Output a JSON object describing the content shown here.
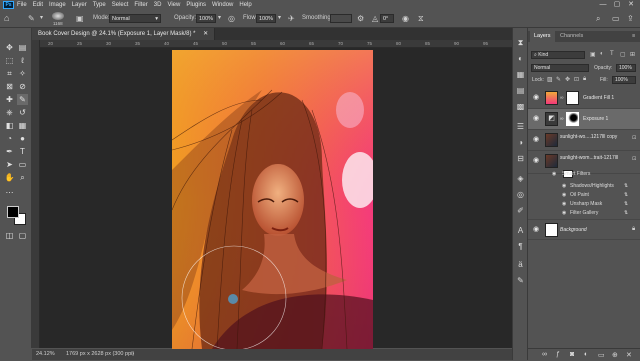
{
  "menu": {
    "logo": "Ps",
    "items": [
      "File",
      "Edit",
      "Image",
      "Layer",
      "Type",
      "Select",
      "Filter",
      "3D",
      "View",
      "Plugins",
      "Window",
      "Help"
    ]
  },
  "window_controls": {
    "minimize": "—",
    "maximize": "▢",
    "close": "✕"
  },
  "options_bar": {
    "brush_size": "1168",
    "mode_label": "Mode:",
    "mode_value": "Normal",
    "opacity_label": "Opacity:",
    "opacity_value": "100%",
    "flow_label": "Flow:",
    "flow_value": "100%",
    "smoothing_label": "Smoothing:",
    "angle_value": "0°"
  },
  "document": {
    "tab_title": "Book Cover Design @ 24.1% (Exposure 1, Layer Mask/8) *",
    "ruler_marks": [
      "20",
      "25",
      "30",
      "35",
      "40",
      "45",
      "50",
      "55",
      "60",
      "65",
      "70",
      "75",
      "80",
      "85",
      "90",
      "95"
    ],
    "zoom": "24.12%",
    "doc_info": "1769 px x 2628 px (300 ppi)"
  },
  "layers_panel": {
    "tabs": [
      "Layers",
      "Channels"
    ],
    "kind_label": "Kind",
    "blend_mode": "Normal",
    "opacity_label": "Opacity:",
    "opacity_value": "100%",
    "lock_label": "Lock:",
    "fill_label": "Fill:",
    "fill_value": "100%",
    "layers": [
      {
        "name": "Gradient Fill 1"
      },
      {
        "name": "Exposure 1"
      },
      {
        "name": "sunlight-wo....1217lll copy"
      },
      {
        "name": "sunlight-wom...trait-1217lll"
      }
    ],
    "smart_filters_label": "Smart Filters",
    "filters": [
      "Shadows/Highlights",
      "Oil Paint",
      "Unsharp Mask",
      "Filter Gallery"
    ],
    "background_layer": "Background"
  },
  "colors": {
    "canvas_top": "#f2a93a",
    "canvas_pink": "#f2387a",
    "canvas_left": "#f0a020",
    "selected_row": "#6a6a6a"
  }
}
